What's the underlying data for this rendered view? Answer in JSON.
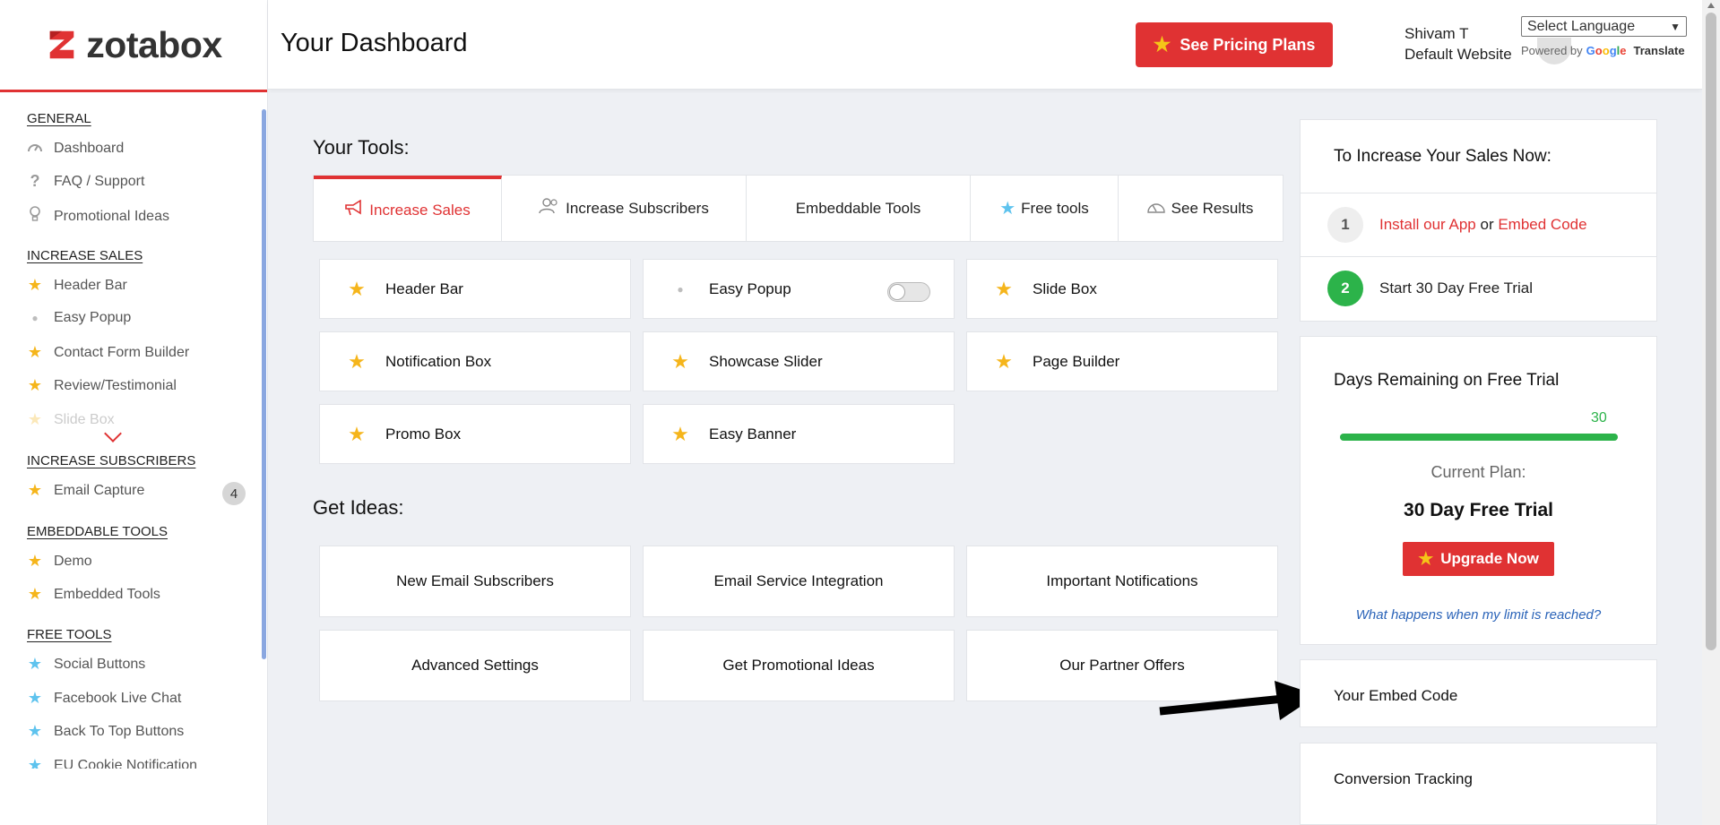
{
  "app": {
    "logo_text": "zotabox"
  },
  "sidebar": {
    "sections": [
      {
        "title": "GENERAL",
        "items": [
          {
            "label": "Dashboard",
            "icon": "dashboard-gauge-icon"
          },
          {
            "label": "FAQ / Support",
            "icon": "question-mark-icon"
          },
          {
            "label": "Promotional Ideas",
            "icon": "lightbulb-icon"
          }
        ]
      },
      {
        "title": "INCREASE SALES",
        "items": [
          {
            "label": "Header Bar",
            "icon": "star-icon"
          },
          {
            "label": "Easy Popup",
            "icon": "dot-icon"
          },
          {
            "label": "Contact Form Builder",
            "icon": "star-icon"
          },
          {
            "label": "Review/Testimonial",
            "icon": "star-icon"
          },
          {
            "label": "Slide Box",
            "icon": "star-icon"
          }
        ]
      },
      {
        "title": "INCREASE SUBSCRIBERS",
        "items": [
          {
            "label": "Email Capture",
            "icon": "star-icon",
            "badge": "4"
          }
        ]
      },
      {
        "title": "EMBEDDABLE TOOLS",
        "items": [
          {
            "label": "Demo",
            "icon": "star-icon"
          },
          {
            "label": "Embedded Tools",
            "icon": "star-icon"
          }
        ]
      },
      {
        "title": "FREE TOOLS",
        "items": [
          {
            "label": "Social Buttons",
            "icon": "star-icon"
          },
          {
            "label": "Facebook Live Chat",
            "icon": "star-icon"
          },
          {
            "label": "Back To Top Buttons",
            "icon": "star-icon"
          },
          {
            "label": "EU Cookie Notification",
            "icon": "star-icon"
          }
        ]
      }
    ]
  },
  "header": {
    "title": "Your Dashboard",
    "pricing_button": "See Pricing Plans",
    "user_name": "Shivam T",
    "user_site": "Default Website",
    "language_select": "Select Language",
    "powered_by": "Powered by",
    "google_word": "Google",
    "translate": "Translate"
  },
  "main": {
    "tools_title": "Your Tools:",
    "tabs": [
      {
        "label": "Increase Sales",
        "icon": "megaphone-icon",
        "active": true
      },
      {
        "label": "Increase Subscribers",
        "icon": "users-icon"
      },
      {
        "label": "Embeddable Tools",
        "icon": ""
      },
      {
        "label": "Free tools",
        "icon": "star-icon"
      },
      {
        "label": "See Results",
        "icon": "chart-gauge-icon"
      }
    ],
    "tools": [
      {
        "label": "Header Bar",
        "icon": "star-icon"
      },
      {
        "label": "Easy Popup",
        "icon": "dot-icon",
        "toggle": "off"
      },
      {
        "label": "Slide Box",
        "icon": "star-icon"
      },
      {
        "label": "Notification Box",
        "icon": "star-icon"
      },
      {
        "label": "Showcase Slider",
        "icon": "star-icon"
      },
      {
        "label": "Page Builder",
        "icon": "star-icon"
      },
      {
        "label": "Promo Box",
        "icon": "star-icon"
      },
      {
        "label": "Easy Banner",
        "icon": "star-icon"
      }
    ],
    "ideas_title": "Get Ideas:",
    "ideas": [
      "New Email Subscribers",
      "Email Service Integration",
      "Important Notifications",
      "Advanced Settings",
      "Get Promotional Ideas",
      "Our Partner Offers"
    ]
  },
  "right": {
    "sales_title": "To Increase Your Sales Now:",
    "step1_num": "1",
    "step1_link1": "Install our App",
    "step1_or": "or",
    "step1_link2": "Embed Code",
    "step2_num": "2",
    "step2_text": "Start 30 Day Free Trial",
    "trial_title": "Days Remaining on Free Trial",
    "trial_days": "30",
    "trial_progress_fraction": 1.0,
    "current_plan_label": "Current Plan:",
    "current_plan": "30 Day Free Trial",
    "upgrade_button": "Upgrade Now",
    "limit_link": "What happens when my limit is reached?",
    "embed_code": "Your Embed Code",
    "conversion_tracking": "Conversion Tracking"
  },
  "colors": {
    "accent_red": "#e03233",
    "star_yellow": "#f5b51b",
    "star_blue": "#5ec3ee",
    "trial_green": "#2cb34a"
  }
}
